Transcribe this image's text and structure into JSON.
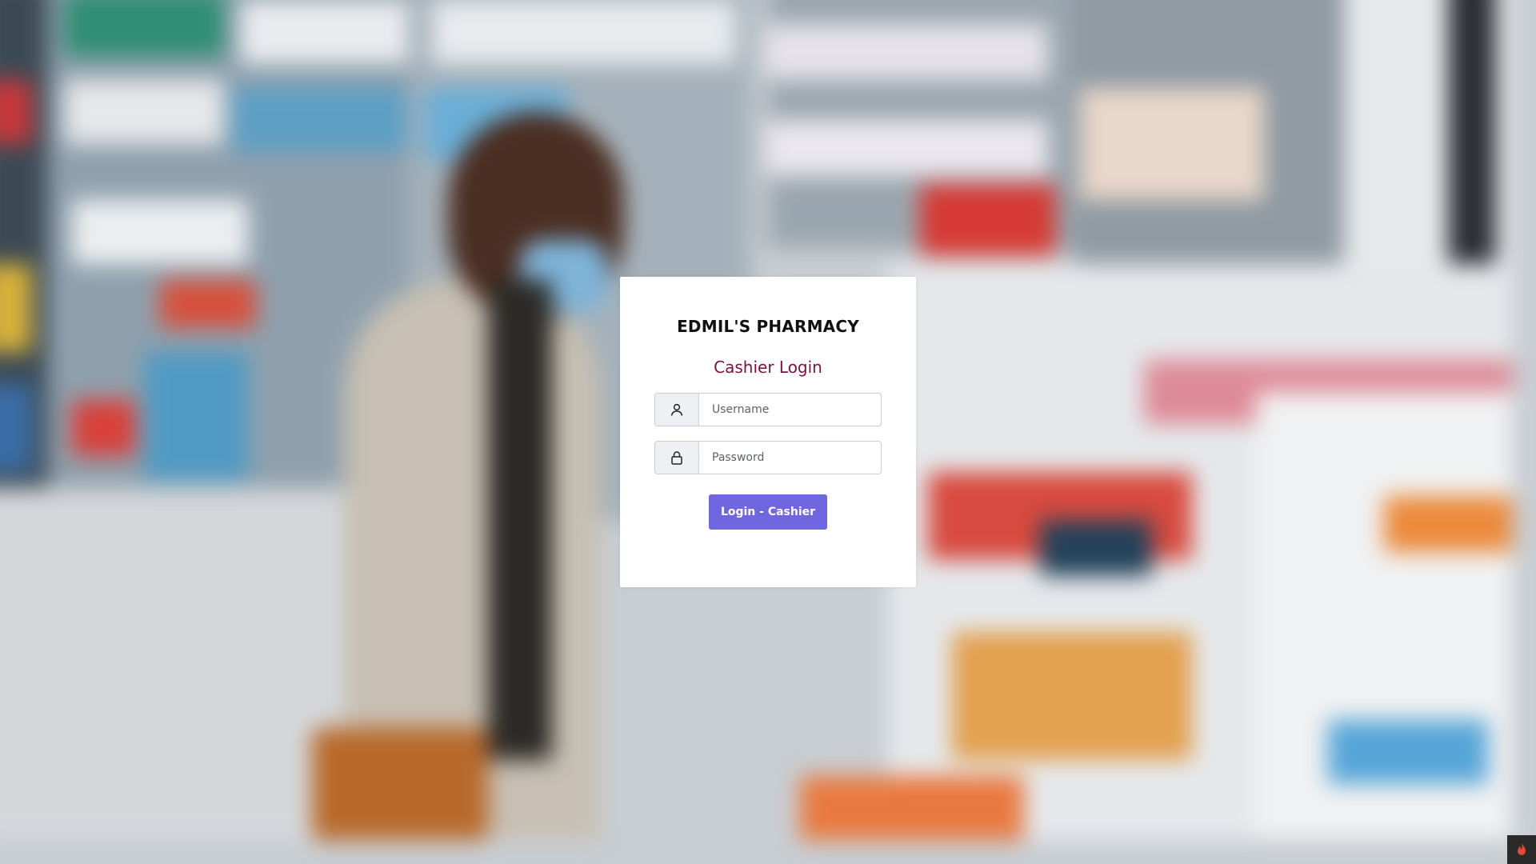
{
  "app": {
    "store_name": "EDMIL'S PHARMACY",
    "login_heading": "Cashier Login"
  },
  "form": {
    "username": {
      "placeholder": "Username",
      "value": "",
      "icon": "user-icon"
    },
    "password": {
      "placeholder": "Password",
      "value": "",
      "icon": "lock-icon"
    },
    "submit_label": "Login - Cashier"
  },
  "colors": {
    "heading": "#111111",
    "subheading": "#7a1242",
    "button": "#7066e0",
    "button_text": "#ffffff",
    "card": "#ffffff"
  },
  "background": {
    "description_icon": "pharmacy-background-image"
  },
  "corner_widget": {
    "icon": "flame-icon"
  }
}
